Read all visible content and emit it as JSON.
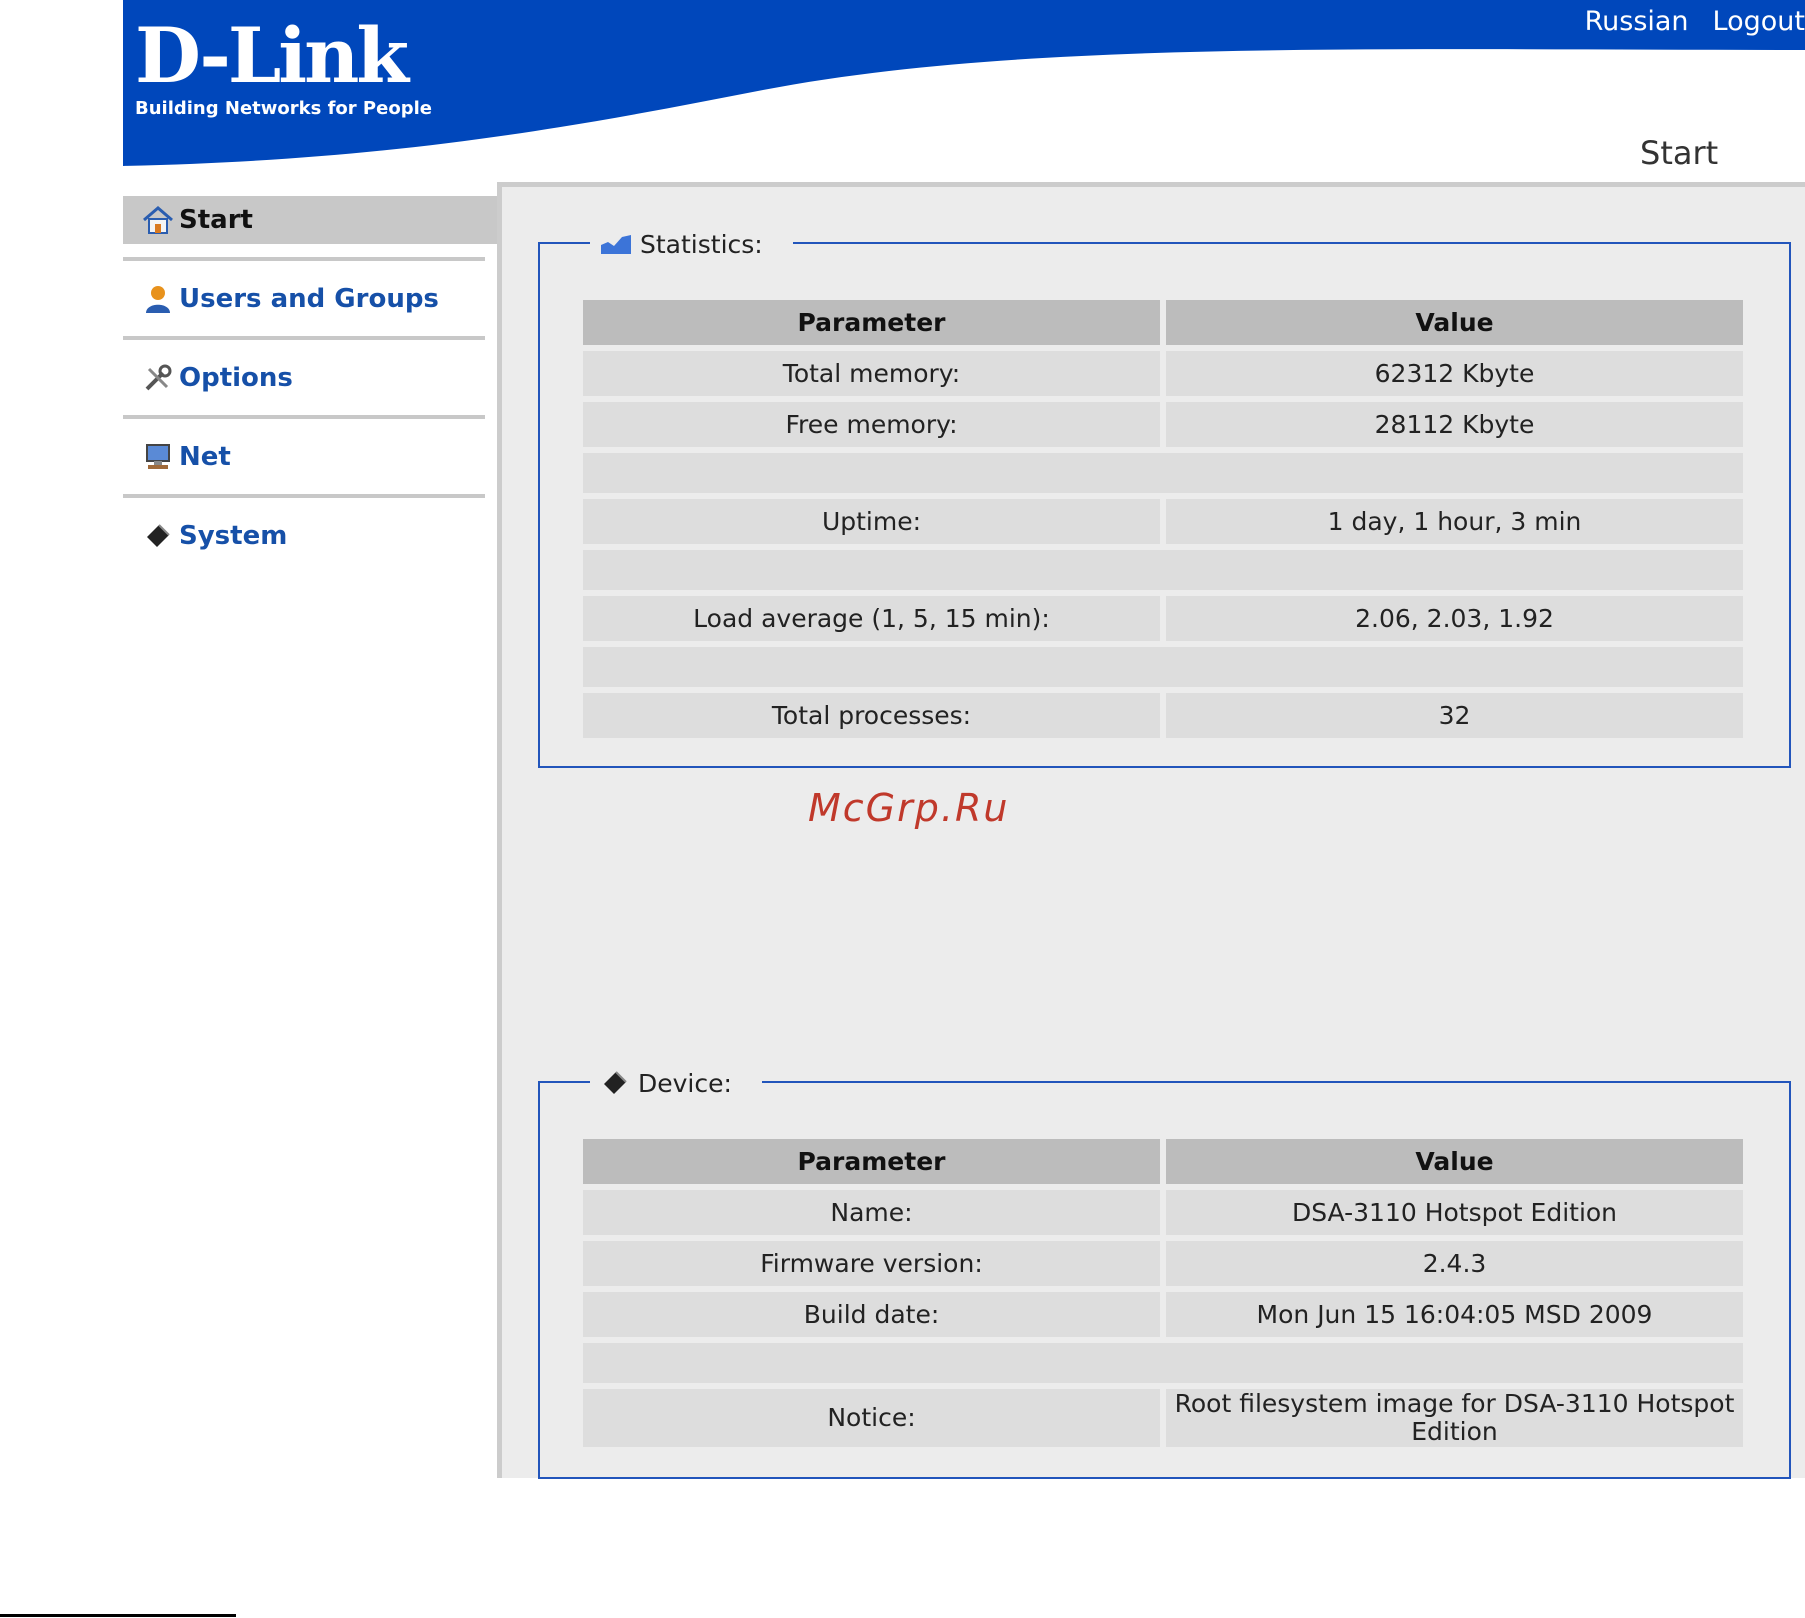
{
  "header": {
    "brand": "D-Link",
    "tagline": "Building Networks for People",
    "links": [
      "Russian",
      "Logout"
    ],
    "page_title": "Start"
  },
  "sidebar": {
    "items": [
      {
        "label": "Start",
        "icon": "home-icon",
        "active": true
      },
      {
        "label": "Users and Groups",
        "icon": "user-icon",
        "active": false
      },
      {
        "label": "Options",
        "icon": "tools-icon",
        "active": false
      },
      {
        "label": "Net",
        "icon": "computer-icon",
        "active": false
      },
      {
        "label": "System",
        "icon": "chip-icon",
        "active": false
      }
    ]
  },
  "statistics": {
    "legend": "Statistics:",
    "headers": [
      "Parameter",
      "Value"
    ],
    "rows": [
      [
        "Total memory:",
        "62312 Kbyte"
      ],
      [
        "Free memory:",
        "28112 Kbyte"
      ],
      [
        "",
        ""
      ],
      [
        "Uptime:",
        "1 day, 1 hour, 3 min"
      ],
      [
        "",
        ""
      ],
      [
        "Load average (1, 5, 15 min):",
        "2.06, 2.03, 1.92"
      ],
      [
        "",
        ""
      ],
      [
        "Total processes:",
        "32"
      ]
    ]
  },
  "device": {
    "legend": "Device:",
    "headers": [
      "Parameter",
      "Value"
    ],
    "rows": [
      [
        "Name:",
        "DSA-3110 Hotspot Edition"
      ],
      [
        "Firmware version:",
        "2.4.3"
      ],
      [
        "Build date:",
        "Mon Jun 15 16:04:05 MSD 2009"
      ],
      [
        "",
        ""
      ],
      [
        "Notice:",
        "Root filesystem image for DSA-3110 Hotspot Edition"
      ]
    ]
  },
  "watermark": "McGrp.Ru",
  "colors": {
    "header_blue": "#0047bb",
    "link_blue": "#1650a8",
    "frame_blue": "#2255bb",
    "watermark_red": "#c0392b"
  }
}
